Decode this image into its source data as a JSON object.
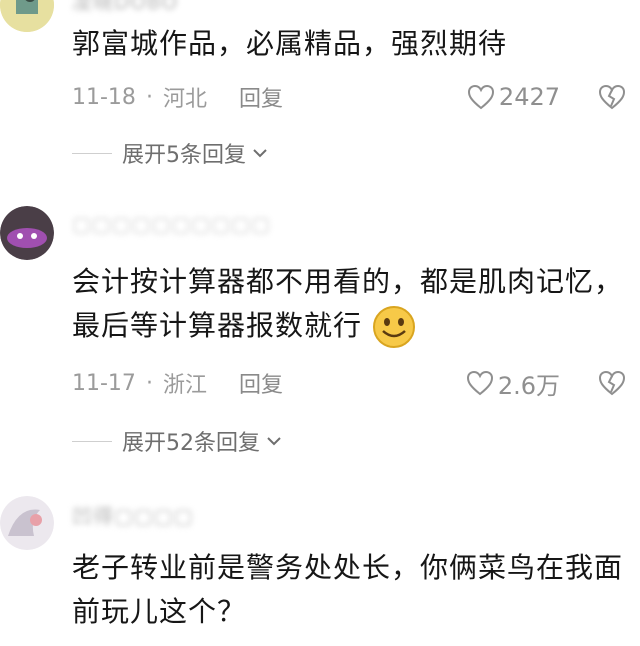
{
  "comments": [
    {
      "username": "凌晓DOBO",
      "text": "郭富城作品，必属精品，强烈期待",
      "date": "11-18",
      "location": "河北",
      "reply_label": "回复",
      "likes": "2427",
      "expand_label": "展开5条回复",
      "avatar_icon": "avatar-icon"
    },
    {
      "username": "▢▢▢▢▢▢▢▢▢▢",
      "text": "会计按计算器都不用看的，都是肌肉记忆，最后等计算器报数就行",
      "date": "11-17",
      "location": "浙江",
      "reply_label": "回复",
      "likes": "2.6万",
      "expand_label": "展开52条回复",
      "avatar_icon": "avatar-icon",
      "emoji": "smiley-emoji-icon"
    },
    {
      "username": "凹得▢▢▢▢",
      "text": "老子转业前是警务处处长，你俩菜鸟在我面前玩儿这个？",
      "avatar_icon": "avatar-icon"
    }
  ],
  "icons": {
    "heart": "heart-outline-icon",
    "dislike": "broken-heart-icon",
    "chevron": "chevron-down-icon"
  },
  "colors": {
    "text": "#161616",
    "meta": "#9b9b9b",
    "expand": "#6e6e6e"
  }
}
